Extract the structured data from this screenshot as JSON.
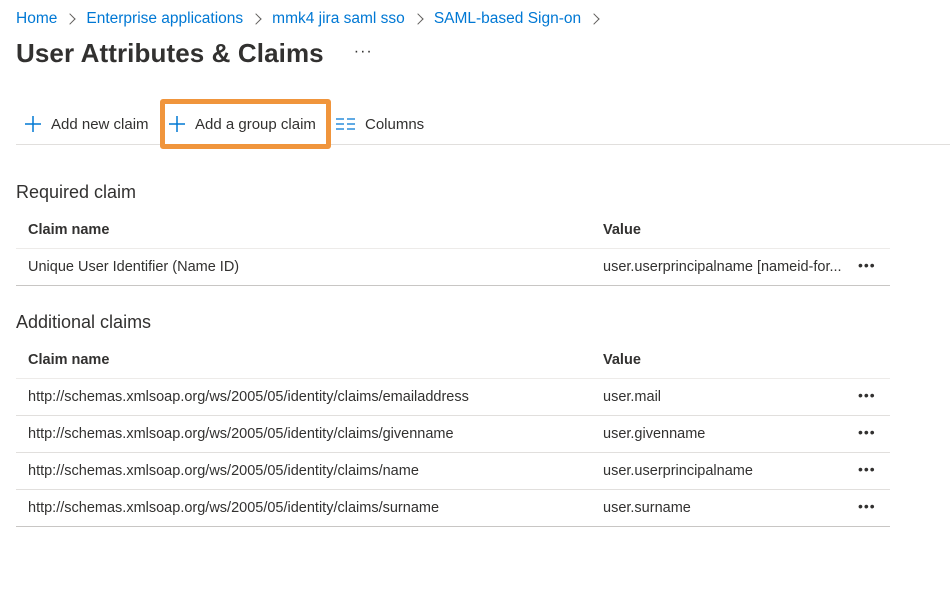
{
  "breadcrumb": {
    "items": [
      "Home",
      "Enterprise applications",
      "mmk4 jira saml sso",
      "SAML-based Sign-on"
    ]
  },
  "page": {
    "title": "User Attributes & Claims",
    "more": "···"
  },
  "toolbar": {
    "add_new_claim": "Add new claim",
    "add_group_claim": "Add a group claim",
    "columns": "Columns",
    "highlight_color": "#f0953c",
    "accent_color": "#0078d4"
  },
  "required": {
    "section_title": "Required claim",
    "headers": {
      "name": "Claim name",
      "value": "Value"
    },
    "rows": [
      {
        "name": "Unique User Identifier (Name ID)",
        "value": "user.userprincipalname [nameid-for...",
        "more": "•••"
      }
    ]
  },
  "additional": {
    "section_title": "Additional claims",
    "headers": {
      "name": "Claim name",
      "value": "Value"
    },
    "rows": [
      {
        "name": "http://schemas.xmlsoap.org/ws/2005/05/identity/claims/emailaddress",
        "value": "user.mail",
        "more": "•••"
      },
      {
        "name": "http://schemas.xmlsoap.org/ws/2005/05/identity/claims/givenname",
        "value": "user.givenname",
        "more": "•••"
      },
      {
        "name": "http://schemas.xmlsoap.org/ws/2005/05/identity/claims/name",
        "value": "user.userprincipalname",
        "more": "•••"
      },
      {
        "name": "http://schemas.xmlsoap.org/ws/2005/05/identity/claims/surname",
        "value": "user.surname",
        "more": "•••"
      }
    ]
  }
}
